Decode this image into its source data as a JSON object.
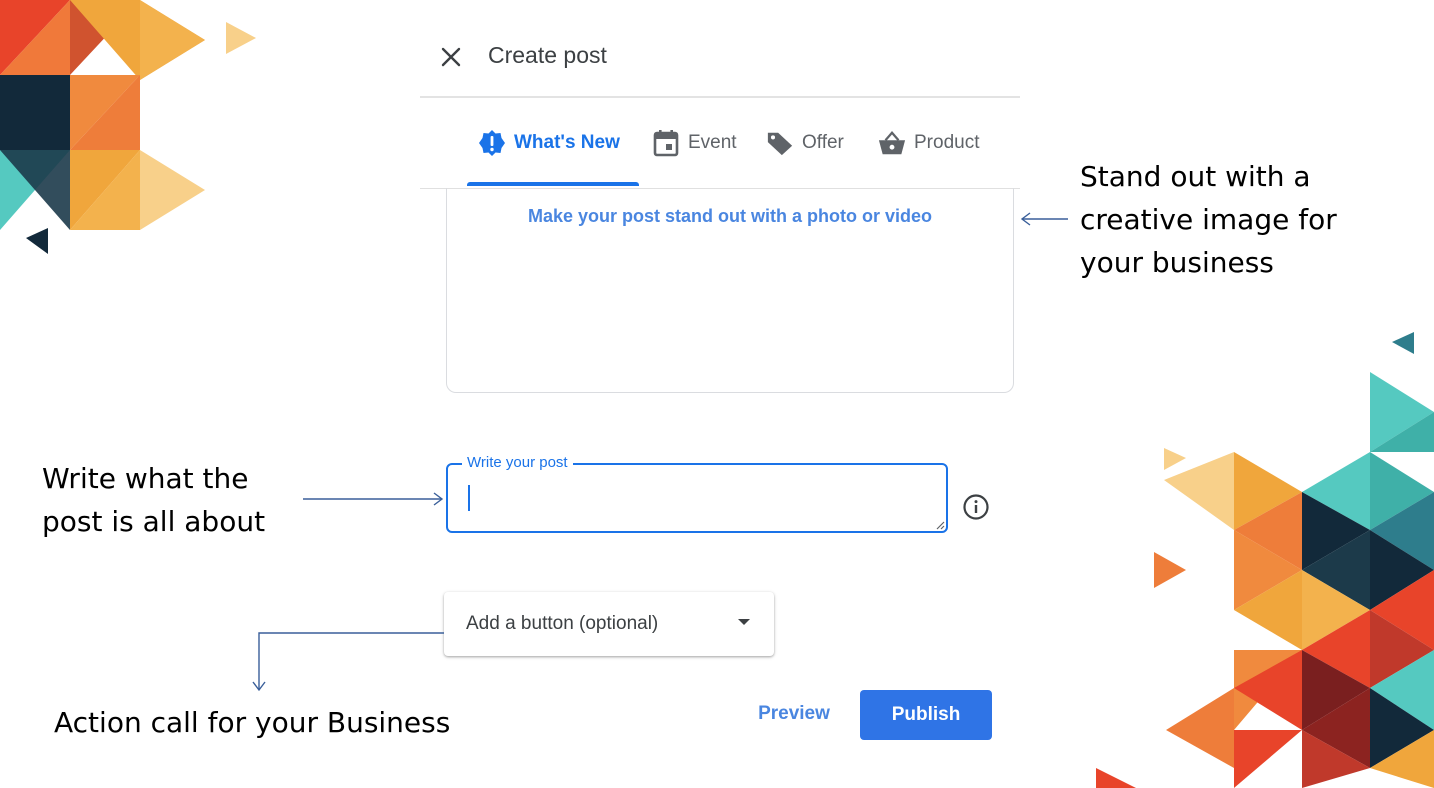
{
  "dialog": {
    "title": "Create post",
    "close_icon": "close-icon"
  },
  "tabs": [
    {
      "label": "What's New",
      "icon": "alert-badge-icon",
      "active": true
    },
    {
      "label": "Event",
      "icon": "calendar-icon",
      "active": false
    },
    {
      "label": "Offer",
      "icon": "tag-icon",
      "active": false
    },
    {
      "label": "Product",
      "icon": "basket-icon",
      "active": false
    }
  ],
  "media": {
    "link_text": "Make your post stand out with a photo or video"
  },
  "post_field": {
    "label": "Write your post",
    "value": ""
  },
  "cta_select": {
    "label": "Add a button (optional)"
  },
  "actions": {
    "preview": "Preview",
    "publish": "Publish"
  },
  "annotations": {
    "image": [
      "Stand out with a",
      "creative image for",
      "your business"
    ],
    "post": [
      "Write what the",
      "post is all about"
    ],
    "action": "Action call for your Business"
  },
  "colors": {
    "accent": "#1a73e8",
    "publish_bg": "#2f74e6",
    "orange": "#f0a63c",
    "red": "#e8442a",
    "teal": "#55c9c0",
    "navy": "#12293a"
  }
}
